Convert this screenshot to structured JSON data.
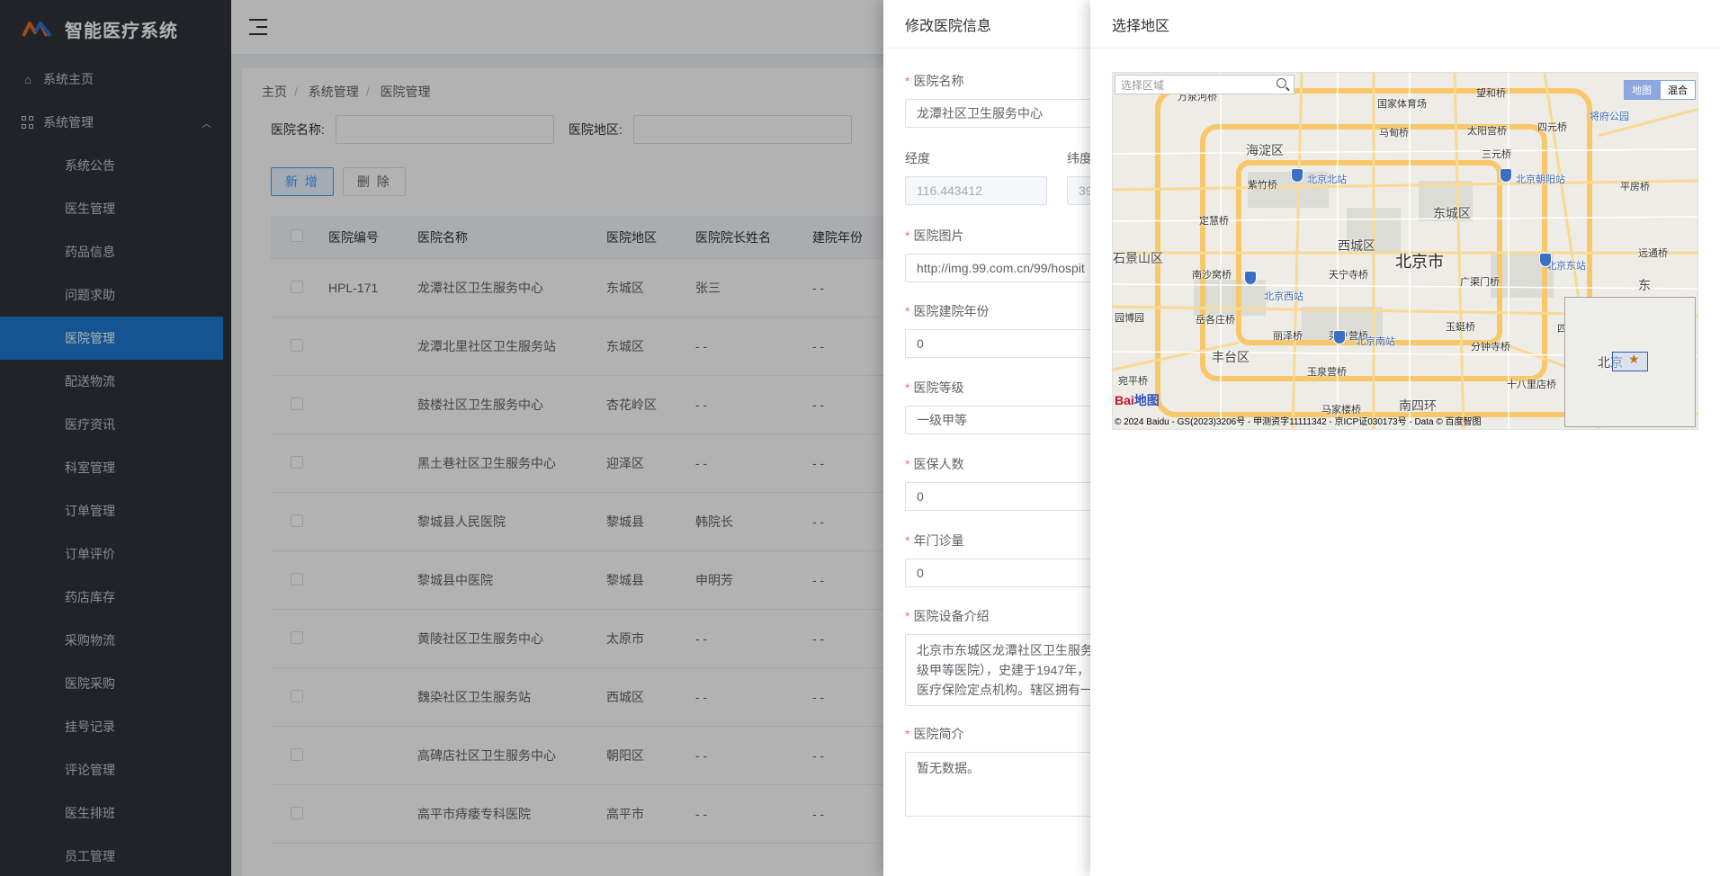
{
  "app": {
    "title": "智能医疗系统"
  },
  "sidebar": {
    "home": "系统主页",
    "group": "系统管理",
    "items": [
      {
        "label": "系统公告"
      },
      {
        "label": "医生管理"
      },
      {
        "label": "药品信息"
      },
      {
        "label": "问题求助"
      },
      {
        "label": "医院管理",
        "active": true
      },
      {
        "label": "配送物流"
      },
      {
        "label": "医疗资讯"
      },
      {
        "label": "科室管理"
      },
      {
        "label": "订单管理"
      },
      {
        "label": "订单评价"
      },
      {
        "label": "药店库存"
      },
      {
        "label": "采购物流"
      },
      {
        "label": "医院采购"
      },
      {
        "label": "挂号记录"
      },
      {
        "label": "评论管理"
      },
      {
        "label": "医生排班"
      },
      {
        "label": "员工管理"
      }
    ]
  },
  "breadcrumb": [
    "主页",
    "系统管理",
    "医院管理"
  ],
  "search": {
    "name_label": "医院名称:",
    "area_label": "医院地区:"
  },
  "buttons": {
    "add": "新 增",
    "delete": "删 除"
  },
  "table": {
    "headers": [
      "医院编号",
      "医院名称",
      "医院地区",
      "医院院长姓名",
      "建院年份"
    ],
    "rows": [
      [
        "HPL-171",
        "龙潭社区卫生服务中心",
        "东城区",
        "张三",
        "- -"
      ],
      [
        "",
        "龙潭北里社区卫生服务站",
        "东城区",
        "- -",
        "- -"
      ],
      [
        "",
        "鼓楼社区卫生服务中心",
        "杏花岭区",
        "- -",
        "- -"
      ],
      [
        "",
        "黑土巷社区卫生服务中心",
        "迎泽区",
        "- -",
        "- -"
      ],
      [
        "",
        "黎城县人民医院",
        "黎城县",
        "韩院长",
        "- -"
      ],
      [
        "",
        "黎城县中医院",
        "黎城县",
        "申明芳",
        "- -"
      ],
      [
        "",
        "黄陵社区卫生服务中心",
        "太原市",
        "- -",
        "- -"
      ],
      [
        "",
        "魏染社区卫生服务站",
        "西城区",
        "- -",
        "- -"
      ],
      [
        "",
        "高碑店社区卫生服务中心",
        "朝阳区",
        "- -",
        "- -"
      ],
      [
        "",
        "高平市痔瘘专科医院",
        "高平市",
        "- -",
        "- -"
      ]
    ]
  },
  "edit_drawer": {
    "title": "修改医院信息",
    "name_label": "医院名称",
    "name_value": "龙潭社区卫生服务中心",
    "lng_label": "经度",
    "lng_value": "116.443412",
    "lat_label": "纬度",
    "lat_value": "39",
    "image_label": "医院图片",
    "image_value": "http://img.99.com.cn/99/hospit",
    "year_label": "医院建院年份",
    "year_value": "0",
    "level_label": "医院等级",
    "level_value": "一级甲等",
    "insured_label": "医保人数",
    "insured_value": "0",
    "visits_label": "年门诊量",
    "visits_value": "0",
    "equip_label": "医院设备介绍",
    "equip_lines": [
      "北京市东城区龙潭社区卫生服务",
      "级甲等医院），史建于1947年，",
      "医疗保险定点机构。辖区拥有一"
    ],
    "intro_label": "医院简介",
    "intro_value": "暂无数据。"
  },
  "region_drawer": {
    "title": "选择地区",
    "search_placeholder": "选择区域",
    "map_types": [
      "地图",
      "混合"
    ],
    "copyright": "© 2024 Baidu - GS(2023)3206号 - 甲测资字11111342 - 京ICP证030173号 - Data © 百度智图",
    "baidu_logo": "Bai",
    "baidu_logo_2": "地图",
    "overview_label": "北京",
    "labels": {
      "haidian": "海淀区",
      "dongcheng": "东城区",
      "xicheng": "西城区",
      "beijing": "北京市",
      "fengtai": "丰台区",
      "shijingshan": "石景山区",
      "wanshou": "万泉河桥",
      "guojia": "国家体育场",
      "wangheqiao": "望和桥",
      "mapoqiao": "马甸桥",
      "taiyanggong": "太阳宫桥",
      "sihuan": "四元桥",
      "sanyuan": "三元桥",
      "ziqiao": "紫竹桥",
      "beijingbei": "北京北站",
      "chaoyang": "北京朝阳站",
      "dingxu": "定慧桥",
      "pingfang": "平房桥",
      "tianning": "天宁寺桥",
      "nanshao": "南沙窝桥",
      "beijingxi": "北京西站",
      "guangqu": "广渠门桥",
      "beijingdong": "北京东站",
      "yuanqiao": "远通桥",
      "yuequan": "岳各庄桥",
      "liuliqiao": "丽泽桥",
      "caihu": "菜户营桥",
      "beijingnan": "北京南站",
      "yuting": "玉蜓桥",
      "fenzhong": "分钟寺桥",
      "sifang": "四方桥",
      "yuquan": "玉泉营桥",
      "shibali": "十八里店桥",
      "majia": "马家楼桥",
      "nansihuan": "南四环",
      "yuanyuan": "园博园",
      "wanping": "宛平桥",
      "jiangfu": "将府公园",
      "dongfang": "东"
    }
  },
  "colors": {
    "accent": "#1e79d1",
    "sidebar_bg": "#30333c",
    "primary": "#409eff"
  }
}
